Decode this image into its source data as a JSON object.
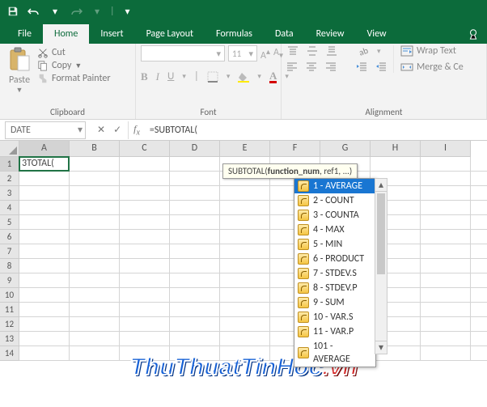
{
  "quickaccess": {
    "save": "save",
    "undo": "undo",
    "redo": "redo"
  },
  "tabs": {
    "file": "File",
    "home": "Home",
    "insert": "Insert",
    "pagelayout": "Page Layout",
    "formulas": "Formulas",
    "data": "Data",
    "review": "Review",
    "view": "View"
  },
  "ribbon": {
    "clipboard": {
      "label": "Clipboard",
      "paste": "Paste",
      "cut": "Cut",
      "copy": "Copy",
      "fmt": "Format Painter"
    },
    "font": {
      "label": "Font",
      "size": "11"
    },
    "alignment": {
      "label": "Alignment",
      "wrap": "Wrap Text",
      "merge": "Merge & Ce"
    }
  },
  "namebox": "DATE",
  "formula": "=SUBTOTAL(",
  "cellA1": "3TOTAL(",
  "tooltip": {
    "fn": "SUBTOTAL",
    "sig": "(function_num, ref1, ...)",
    "bold": "function_num"
  },
  "options": [
    {
      "label": "1 - AVERAGE"
    },
    {
      "label": "2 - COUNT"
    },
    {
      "label": "3 - COUNTA"
    },
    {
      "label": "4 - MAX"
    },
    {
      "label": "5 - MIN"
    },
    {
      "label": "6 - PRODUCT"
    },
    {
      "label": "7 - STDEV.S"
    },
    {
      "label": "8 - STDEV.P"
    },
    {
      "label": "9 - SUM"
    },
    {
      "label": "10 - VAR.S"
    },
    {
      "label": "11 - VAR.P"
    },
    {
      "label": "101 - AVERAGE"
    }
  ],
  "cols": [
    "A",
    "B",
    "C",
    "D",
    "E",
    "F",
    "G",
    "H",
    "I"
  ],
  "rows": [
    "1",
    "2",
    "3",
    "4",
    "5",
    "6",
    "7",
    "8",
    "9",
    "10",
    "11",
    "12",
    "13",
    "14"
  ],
  "watermark": {
    "a": "ThuThuatTinHoc",
    "b": ".vn"
  }
}
